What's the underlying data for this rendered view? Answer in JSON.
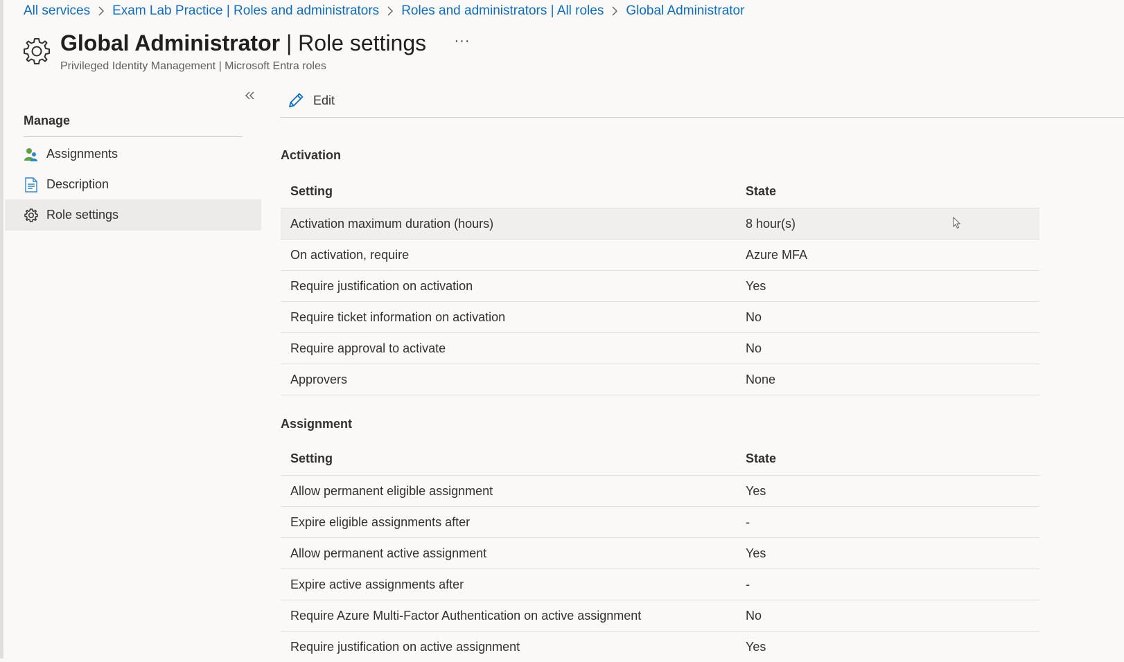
{
  "breadcrumb": {
    "items": [
      "All services",
      "Exam Lab Practice | Roles and administrators",
      "Roles and administrators | All roles",
      "Global Administrator"
    ]
  },
  "header": {
    "title_bold": "Global Administrator",
    "title_rest": " | Role settings",
    "more_label": "···",
    "subtitle": "Privileged Identity Management | Microsoft Entra roles",
    "icon": "gear-icon"
  },
  "sidebar": {
    "collapse_icon": "double-chevron-left-icon",
    "heading": "Manage",
    "items": [
      {
        "label": "Assignments",
        "icon": "users-icon",
        "active": false
      },
      {
        "label": "Description",
        "icon": "document-icon",
        "active": false
      },
      {
        "label": "Role settings",
        "icon": "gear-icon",
        "active": true
      }
    ]
  },
  "toolbar": {
    "edit_label": "Edit",
    "edit_icon": "pencil-icon"
  },
  "activation": {
    "title": "Activation",
    "col_setting": "Setting",
    "col_state": "State",
    "rows": [
      {
        "setting": "Activation maximum duration (hours)",
        "state": "8 hour(s)"
      },
      {
        "setting": "On activation, require",
        "state": "Azure MFA"
      },
      {
        "setting": "Require justification on activation",
        "state": "Yes"
      },
      {
        "setting": "Require ticket information on activation",
        "state": "No"
      },
      {
        "setting": "Require approval to activate",
        "state": "No"
      },
      {
        "setting": "Approvers",
        "state": "None"
      }
    ]
  },
  "assignment": {
    "title": "Assignment",
    "col_setting": "Setting",
    "col_state": "State",
    "rows": [
      {
        "setting": "Allow permanent eligible assignment",
        "state": "Yes"
      },
      {
        "setting": "Expire eligible assignments after",
        "state": "-"
      },
      {
        "setting": "Allow permanent active assignment",
        "state": "Yes"
      },
      {
        "setting": "Expire active assignments after",
        "state": "-"
      },
      {
        "setting": "Require Azure Multi-Factor Authentication on active assignment",
        "state": "No"
      },
      {
        "setting": "Require justification on active assignment",
        "state": "Yes"
      }
    ]
  },
  "colors": {
    "link": "#0f6cbd",
    "active_bg": "#edebe9",
    "hover_row_bg": "#f0efee",
    "page_bg": "#faf9f8"
  }
}
